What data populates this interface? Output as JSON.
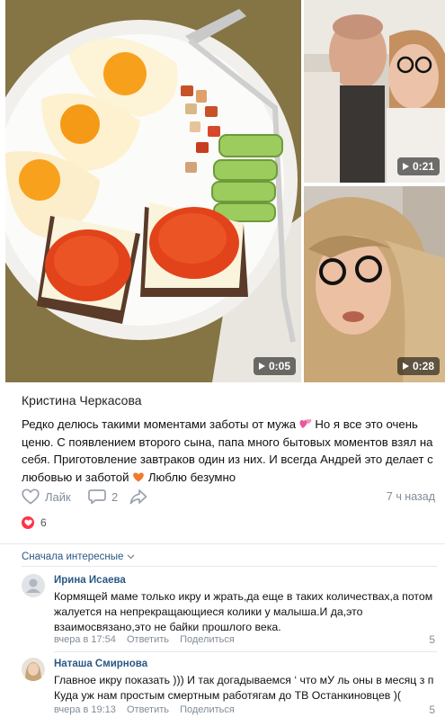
{
  "post": {
    "media": [
      {
        "kind": "video",
        "duration": "0:05",
        "subject": "breakfast-plate"
      },
      {
        "kind": "video",
        "duration": "0:21",
        "subject": "couple-selfie"
      },
      {
        "kind": "video",
        "duration": "0:28",
        "subject": "woman-selfie"
      }
    ],
    "author": "Кристина Черкасова",
    "text_line1": "Редко делюсь такими моментами заботы от мужа",
    "text_line1_tail": " Но я все это очень",
    "text_line2": "ценю. С появлением второго сына, папа много бытовых моментов взял на",
    "text_line3": "себя. Приготовление завтраков один из них. И всегда Андрей это делает с",
    "text_line4": "любовью и заботой",
    "text_line4_tail": " Люблю безумно",
    "emoji_1": "two-hearts-icon",
    "emoji_2": "orange-heart-icon",
    "like_label": "Лайк",
    "comments_count": "2",
    "time": "7 ч назад",
    "reactions_count": "6"
  },
  "comments_header": {
    "sort_label": "Сначала интересные"
  },
  "comments": [
    {
      "name": "Ирина Исаева",
      "line1": "Кормящей маме только икру и жрать,да еще в таких количествах,а потом",
      "line2": "жалуется на непрекращающиеся колики у малыша.И да,это",
      "line3": "взаимосвязано,это не байки прошлого века.",
      "date": "вчера в 17:54",
      "reply": "Ответить",
      "share": "Поделиться",
      "likes": "5"
    },
    {
      "name": "Наташа Смирнова",
      "line1": "Главное икру показать ))) И так догадываемся ‘ что мУ ль оны в месяц з п",
      "line2": "Куда уж нам простым смертным работягам до ТВ Останкиновцев )(",
      "date": "вчера в 19:13",
      "reply": "Ответить",
      "share": "Поделиться",
      "likes": "5"
    }
  ],
  "colors": {
    "link": "#2a5885",
    "muted": "#818c99",
    "reaction": "#ff3347",
    "caviar": "#e2431b"
  }
}
